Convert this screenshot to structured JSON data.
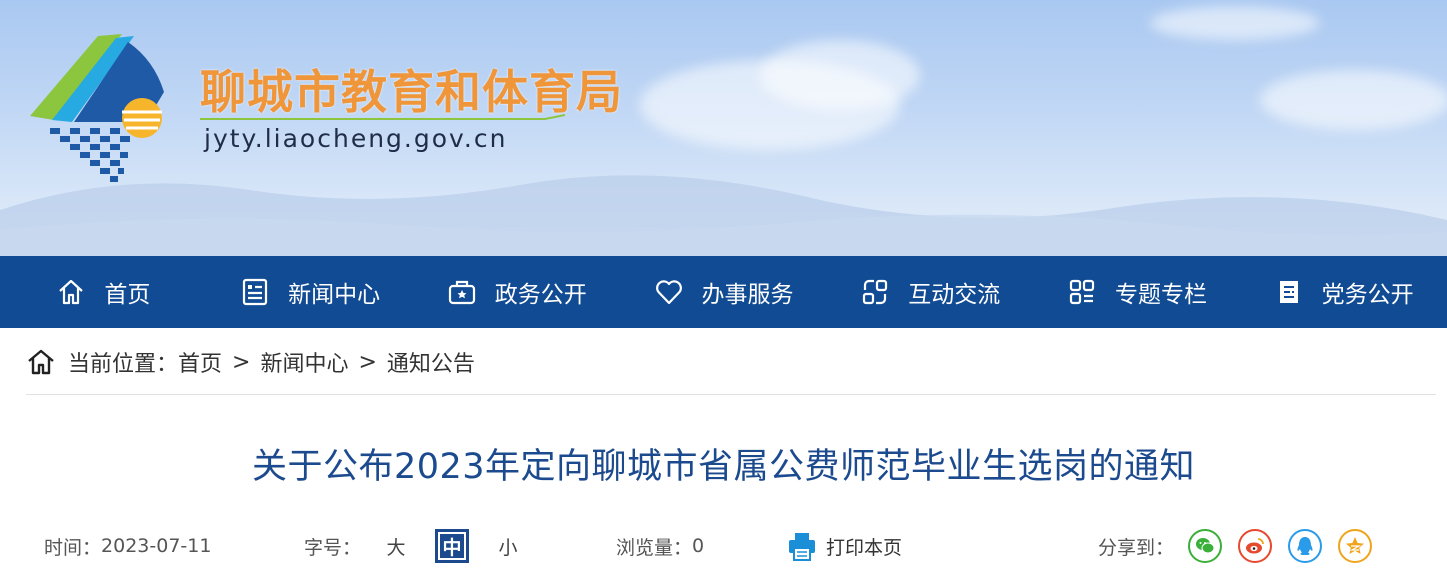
{
  "header": {
    "site_name": "聊城市教育和体育局",
    "site_url": "jyty.liaocheng.gov.cn"
  },
  "nav": {
    "items": [
      {
        "label": "首页",
        "icon": "home-icon"
      },
      {
        "label": "新闻中心",
        "icon": "news-icon"
      },
      {
        "label": "政务公开",
        "icon": "gov-icon"
      },
      {
        "label": "办事服务",
        "icon": "heart-icon"
      },
      {
        "label": "互动交流",
        "icon": "interact-icon"
      },
      {
        "label": "专题专栏",
        "icon": "grid-icon"
      },
      {
        "label": "党务公开",
        "icon": "party-icon"
      }
    ],
    "background": "#114b93"
  },
  "breadcrumb": {
    "prefix": "当前位置：",
    "items": [
      "首页",
      "新闻中心",
      "通知公告"
    ],
    "separator": ">"
  },
  "article": {
    "title": "关于公布2023年定向聊城市省属公费师范毕业生选岗的通知",
    "title_color": "#1c4a8e",
    "time_label": "时间：",
    "time_value": "2023-07-11",
    "font_size_label": "字号：",
    "font_sizes": [
      "大",
      "中",
      "小"
    ],
    "font_size_selected": "中",
    "views_label": "浏览量：",
    "views_value": "0",
    "print_label": "打印本页",
    "share_label": "分享到："
  },
  "share": {
    "targets": [
      {
        "name": "wechat-icon",
        "color": "#3aaf3a"
      },
      {
        "name": "weibo-icon",
        "color": "#e6492d"
      },
      {
        "name": "qq-icon",
        "color": "#2a9be8"
      },
      {
        "name": "qzone-icon",
        "color": "#f0a41d"
      }
    ]
  }
}
